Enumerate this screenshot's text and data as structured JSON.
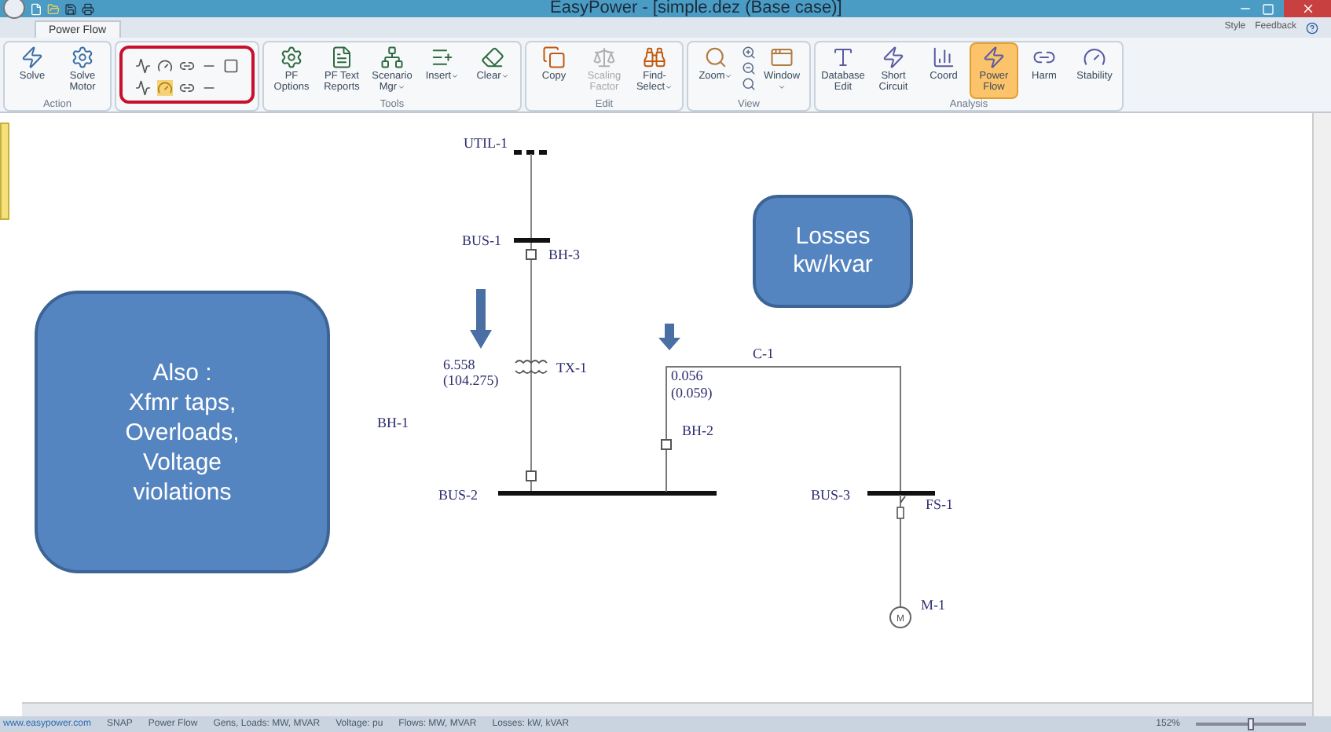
{
  "window": {
    "title": "EasyPower - [simple.dez  (Base case)]"
  },
  "ribbon_tabs": [
    {
      "label": "Power Flow",
      "selected": true
    }
  ],
  "ribbon_links": [
    "Style",
    "Feedback"
  ],
  "ribbon_groups": [
    {
      "label": "Action",
      "buttons": [
        {
          "label": "Solve",
          "selected": false,
          "disabled": false,
          "dropdown": false
        },
        {
          "label": "Solve Motor",
          "selected": false,
          "disabled": false,
          "dropdown": false
        }
      ]
    },
    {
      "circled": true,
      "small_tools": [
        {
          "highlighted": false
        },
        {
          "highlighted": false
        },
        {
          "highlighted": false
        },
        {
          "highlighted": false
        },
        {
          "highlighted": false
        },
        {
          "highlighted": false
        },
        {
          "highlighted": true
        },
        {
          "highlighted": false
        },
        {
          "highlighted": false
        }
      ]
    },
    {
      "label": "Tools",
      "buttons": [
        {
          "label": "PF Options",
          "selected": false,
          "disabled": false,
          "dropdown": false
        },
        {
          "label": "PF Text Reports",
          "selected": false,
          "disabled": false,
          "dropdown": false
        },
        {
          "label": "Scenario Mgr",
          "selected": false,
          "disabled": false,
          "dropdown": true
        },
        {
          "label": "Insert",
          "selected": false,
          "disabled": false,
          "dropdown": true
        },
        {
          "label": "Clear",
          "selected": false,
          "disabled": false,
          "dropdown": true
        }
      ]
    },
    {
      "label": "Edit",
      "buttons": [
        {
          "label": "Copy",
          "selected": false,
          "disabled": false,
          "dropdown": false
        },
        {
          "label": "Scaling Factor",
          "selected": false,
          "disabled": true,
          "dropdown": false
        },
        {
          "label": "Find-Select",
          "selected": false,
          "disabled": false,
          "dropdown": true
        }
      ]
    },
    {
      "label": "View",
      "buttons": [
        {
          "label": "Zoom",
          "selected": false,
          "disabled": false,
          "dropdown": true
        },
        {
          "label": "Window",
          "selected": false,
          "disabled": false,
          "dropdown": true
        }
      ]
    },
    {
      "label": "Analysis",
      "buttons": [
        {
          "label": "Database Edit",
          "selected": false,
          "disabled": false,
          "dropdown": false
        },
        {
          "label": "Short Circuit",
          "selected": false,
          "disabled": false,
          "dropdown": false
        },
        {
          "label": "Coord",
          "selected": false,
          "disabled": false,
          "dropdown": false
        },
        {
          "label": "Power Flow",
          "selected": true,
          "disabled": false,
          "dropdown": false
        },
        {
          "label": "Harm",
          "selected": false,
          "disabled": false,
          "dropdown": false
        },
        {
          "label": "Stability",
          "selected": false,
          "disabled": false,
          "dropdown": false
        }
      ]
    }
  ],
  "diagram": {
    "labels": {
      "util": "UTIL-1",
      "bus1": "BUS-1",
      "bh3": "BH-3",
      "tx1": "TX-1",
      "bh1": "BH-1",
      "bus2": "BUS-2",
      "c1": "C-1",
      "bh2": "BH-2",
      "bus3": "BUS-3",
      "fs1": "FS-1",
      "m1": "M-1",
      "motor": "M"
    },
    "flows": [
      {
        "value": "6.558",
        "reactive": "(104.275)"
      },
      {
        "value": "0.056",
        "reactive": "(0.059)"
      }
    ],
    "callouts": [
      {
        "lines": [
          "Also :",
          "Xfmr taps,",
          "Overloads,",
          "Voltage",
          "violations"
        ]
      },
      {
        "lines": [
          "Losses",
          "kw/kvar"
        ]
      }
    ]
  },
  "status_bar": {
    "items": [
      "www.easypower.com",
      "SNAP",
      "Power Flow",
      "Gens, Loads: MW, MVAR",
      "Voltage: pu",
      "Flows: MW, MVAR",
      "Losses: kW, kVAR"
    ],
    "zoom": "152%",
    "zoom_slider": {
      "level": 0.5
    }
  }
}
